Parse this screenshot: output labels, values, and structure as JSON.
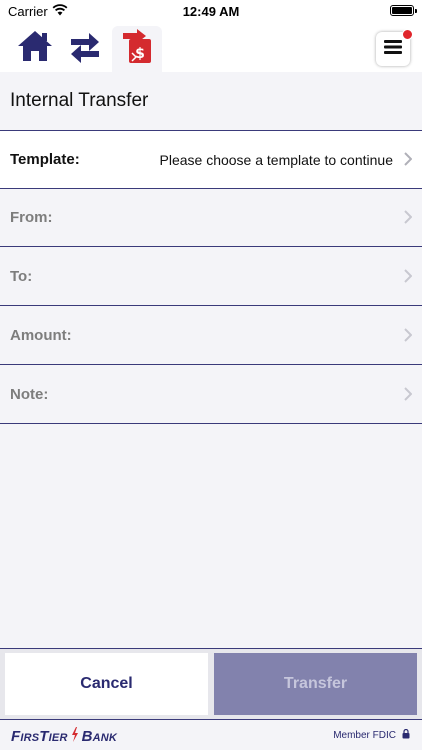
{
  "status_bar": {
    "carrier": "Carrier",
    "time": "12:49 AM"
  },
  "nav": {
    "home_icon": "home-icon",
    "transfers_icon": "transfers-icon",
    "internal_transfer_icon": "internal-transfer-icon",
    "menu_icon": "hamburger-menu-icon",
    "notification_color": "#e0252b"
  },
  "page": {
    "title": "Internal Transfer"
  },
  "form": {
    "template_label": "Template:",
    "template_value": "Please choose a template to continue",
    "from_label": "From:",
    "to_label": "To:",
    "amount_label": "Amount:",
    "note_label": "Note:"
  },
  "actions": {
    "cancel_label": "Cancel",
    "transfer_label": "Transfer"
  },
  "footer": {
    "brand_prefix": "FirsTier",
    "brand_suffix": "Bank",
    "member_text": "Member FDIC"
  },
  "colors": {
    "accent": "#2a2a70",
    "bank_red": "#d42a2f",
    "disabled_button": "#8282ad"
  }
}
